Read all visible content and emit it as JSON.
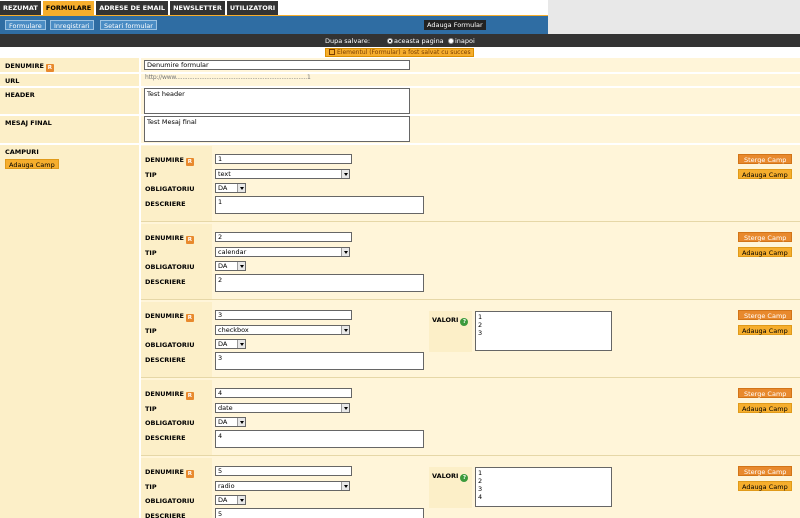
{
  "tabs": [
    "REZUMAT",
    "FORMULARE",
    "ADRESE DE EMAIL",
    "NEWSLETTER",
    "UTILIZATORI"
  ],
  "active_tab": "FORMULARE",
  "subnav": {
    "formulare": "Formulare",
    "inregistrari": "Inregistrari",
    "setari": "Setari formular",
    "adauga_formular": "Adauga Formular"
  },
  "after_save": {
    "label": "Dupa salvare:",
    "option1": "aceasta pagina",
    "option2": "inapoi",
    "selected": "aceasta pagina"
  },
  "notice": "Elementul (Formular) a fost salvat cu succes",
  "form": {
    "denumire_label": "DENUMIRE",
    "denumire_value": "Denumire formular",
    "url_label": "URL",
    "url_value": "http://www.............................................................................1",
    "header_label": "HEADER",
    "header_value": "Test header",
    "mesaj_label": "MESAJ FINAL",
    "mesaj_value": "Test Mesaj final",
    "campuri_label": "CAMPURI",
    "adauga_camp_label": "Adauga Camp"
  },
  "field_labels": {
    "denumire": "DENUMIRE",
    "tip": "TIP",
    "obligatoriu": "OBLIGATORIU",
    "descriere": "DESCRIERE",
    "valori": "VALORI"
  },
  "badges": {
    "required": "R",
    "help": "?"
  },
  "buttons": {
    "sterge": "Sterge Camp",
    "adauga": "Adauga Camp"
  },
  "fields": [
    {
      "denumire": "1",
      "tip": "text",
      "obligatoriu": "DA",
      "descriere": "1",
      "valori": null
    },
    {
      "denumire": "2",
      "tip": "calendar",
      "obligatoriu": "DA",
      "descriere": "2",
      "valori": null
    },
    {
      "denumire": "3",
      "tip": "checkbox",
      "obligatoriu": "DA",
      "descriere": "3",
      "valori": "1\n2\n3"
    },
    {
      "denumire": "4",
      "tip": "date",
      "obligatoriu": "DA",
      "descriere": "4",
      "valori": null
    },
    {
      "denumire": "5",
      "tip": "radio",
      "obligatoriu": "DA",
      "descriere": "5",
      "valori": "1\n2\n3\n4"
    }
  ]
}
